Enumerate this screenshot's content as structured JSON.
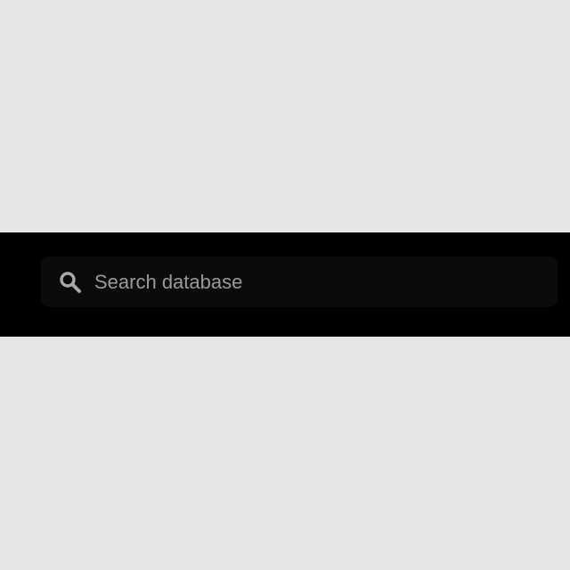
{
  "search": {
    "placeholder": "Search database",
    "value": "",
    "icon": "search-icon"
  },
  "colors": {
    "page_background": "#e6e6e6",
    "bar_background": "#000000",
    "field_background": "#0b0b0b",
    "placeholder_text": "#9a9a9a",
    "icon": "#a8a8a8"
  }
}
